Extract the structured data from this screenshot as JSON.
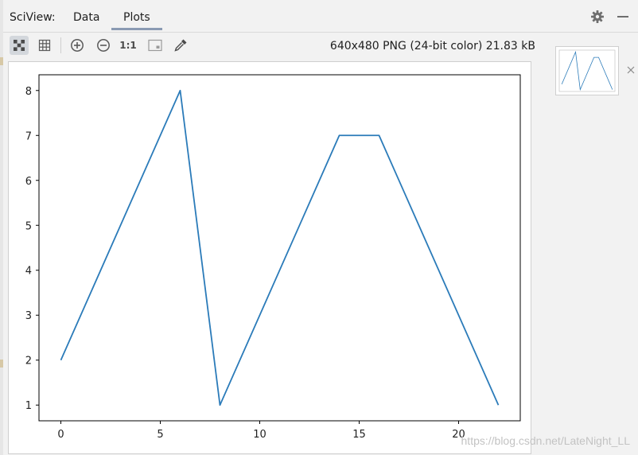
{
  "panel": {
    "prefix": "SciView:"
  },
  "tabs": [
    {
      "label": "Data",
      "active": false
    },
    {
      "label": "Plots",
      "active": true
    }
  ],
  "toolbar": {
    "image_info": "640x480 PNG (24-bit color) 21.83 kB",
    "actual_size_label": "1:1",
    "icons": [
      "checkerboard-icon",
      "grid-icon",
      "zoom-in-icon",
      "zoom-out-icon",
      "fit-screen-icon",
      "color-picker-icon"
    ]
  },
  "header_icons": [
    "gear-icon",
    "minimize-icon"
  ],
  "thumbnail_close_icon": "close-icon",
  "watermark": "https://blog.csdn.net/LateNight_LL",
  "colors": {
    "line": "#2b7bb9",
    "active_tab_underline": "#8a9ab3"
  },
  "chart_data": {
    "type": "line",
    "x": [
      0,
      6,
      8,
      14,
      16,
      22
    ],
    "y": [
      2,
      8,
      1,
      7,
      7,
      1
    ],
    "xticks": [
      0,
      5,
      10,
      15,
      20
    ],
    "yticks": [
      1,
      2,
      3,
      4,
      5,
      6,
      7,
      8
    ],
    "xlim": [
      -1.1,
      23.1
    ],
    "ylim": [
      0.65,
      8.35
    ],
    "title": "",
    "xlabel": "",
    "ylabel": "",
    "grid": false
  }
}
